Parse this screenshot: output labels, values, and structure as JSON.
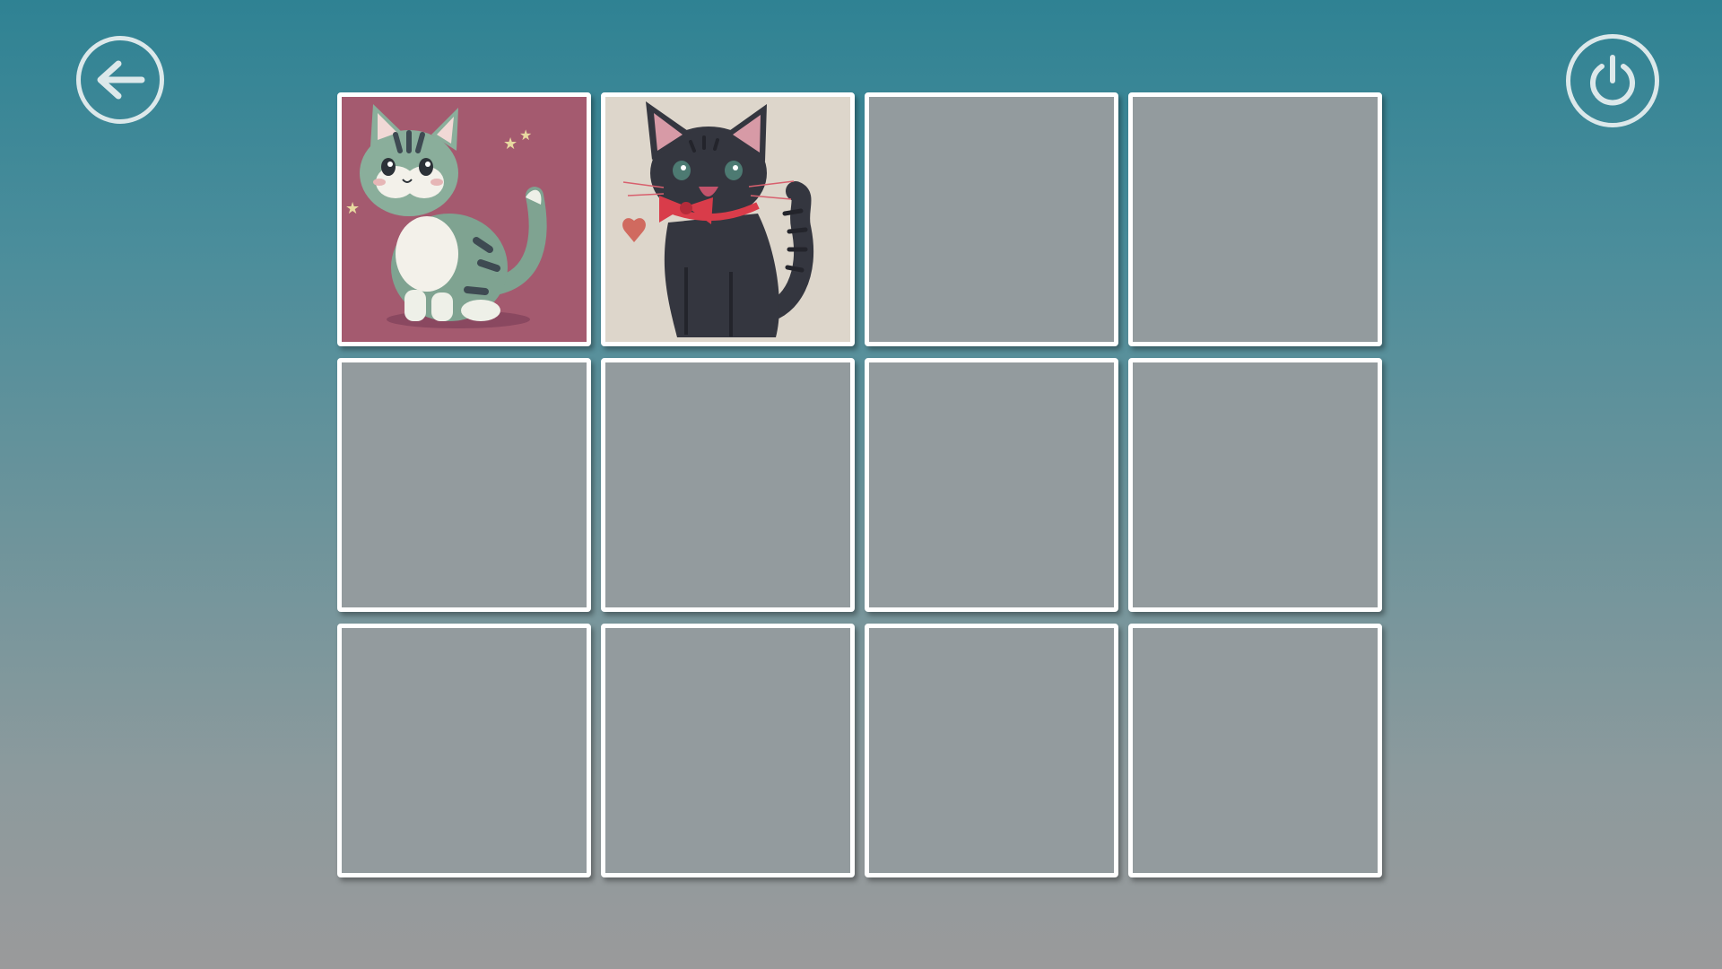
{
  "controls": {
    "back_icon": "arrow-left-icon",
    "power_icon": "power-icon"
  },
  "colors": {
    "background_top": "#2f8293",
    "background_bottom": "#9a9a9b",
    "card_back": "#939b9e",
    "card_border": "#ffffff",
    "icon_stroke": "#dce8ea"
  },
  "board": {
    "rows": 3,
    "columns": 4,
    "cards": [
      {
        "state": "face-up",
        "image": "green-tabby-kitten"
      },
      {
        "state": "face-up",
        "image": "black-cat-red-bow"
      },
      {
        "state": "face-down",
        "image": ""
      },
      {
        "state": "face-down",
        "image": ""
      },
      {
        "state": "face-down",
        "image": ""
      },
      {
        "state": "face-down",
        "image": ""
      },
      {
        "state": "face-down",
        "image": ""
      },
      {
        "state": "face-down",
        "image": ""
      },
      {
        "state": "face-down",
        "image": ""
      },
      {
        "state": "face-down",
        "image": ""
      },
      {
        "state": "face-down",
        "image": ""
      },
      {
        "state": "face-down",
        "image": ""
      }
    ]
  }
}
